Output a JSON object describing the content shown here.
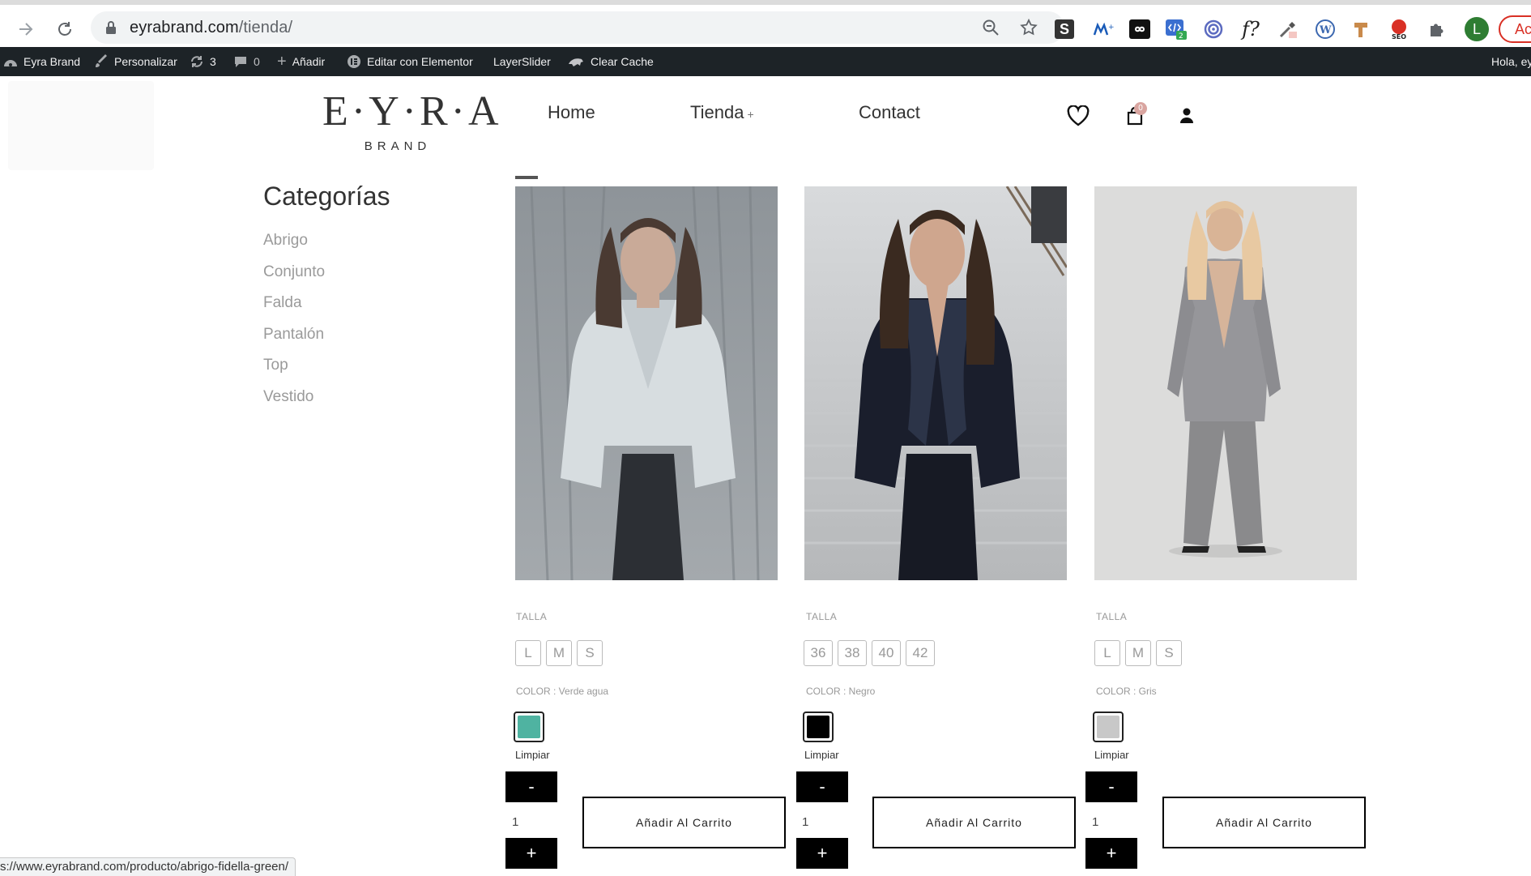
{
  "browser": {
    "url_domain": "eyrabrand.com",
    "url_path": "/tienda/",
    "extensions": [
      "s-extension-icon",
      "movistar-icon",
      "infinity-icon",
      "code-icon",
      "target-icon",
      "font-icon",
      "eyedropper-icon",
      "wordpress-icon",
      "tag-icon",
      "seo-icon",
      "puzzle-icon"
    ],
    "ext_badge": "2",
    "profile_initial": "L",
    "update_label": "Ac"
  },
  "adminbar": {
    "site": "Eyra Brand",
    "customize": "Personalizar",
    "updates": "3",
    "comments": "0",
    "add_new": "Añadir",
    "elementor": "Editar con Elementor",
    "layerslider": "LayerSlider",
    "clear_cache": "Clear Cache",
    "greeting": "Hola, ey"
  },
  "header": {
    "logo_main": "E·Y·R·A",
    "logo_sub": "BRAND",
    "menu": [
      {
        "label": "Home"
      },
      {
        "label": "Tienda",
        "suffix": "+"
      },
      {
        "label": "Contact"
      }
    ],
    "cart_count": "0"
  },
  "sidebar": {
    "title": "Categorías",
    "categories": [
      "Abrigo",
      "Conjunto",
      "Falda",
      "Pantalón",
      "Top",
      "Vestido"
    ]
  },
  "products": [
    {
      "size_label": "TALLA",
      "sizes": [
        "L",
        "M",
        "S"
      ],
      "color_label": "COLOR : Verde agua",
      "swatch": "#4fb3a1",
      "clear": "Limpiar",
      "minus": "-",
      "plus": "+",
      "qty": "1",
      "add_to_cart": "Añadir Al Carrito"
    },
    {
      "size_label": "TALLA",
      "sizes": [
        "36",
        "38",
        "40",
        "42"
      ],
      "color_label": "COLOR : Negro",
      "swatch": "#000000",
      "clear": "Limpiar",
      "minus": "-",
      "plus": "+",
      "qty": "1",
      "add_to_cart": "Añadir Al Carrito"
    },
    {
      "size_label": "TALLA",
      "sizes": [
        "L",
        "M",
        "S"
      ],
      "color_label": "COLOR : Gris",
      "swatch": "#c8c8c8",
      "clear": "Limpiar",
      "minus": "-",
      "plus": "+",
      "qty": "1",
      "add_to_cart": "Añadir Al Carrito"
    }
  ],
  "status_url": "s://www.eyrabrand.com/producto/abrigo-fidella-green/"
}
